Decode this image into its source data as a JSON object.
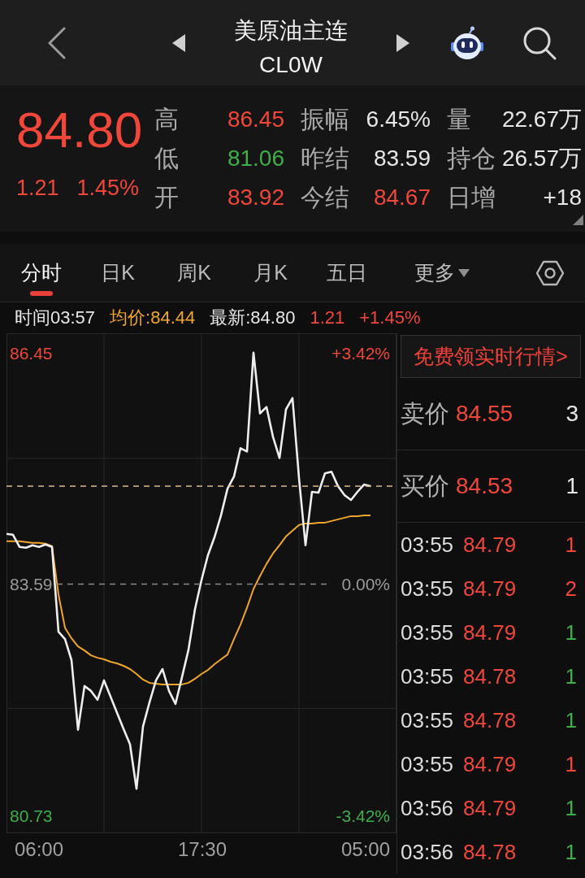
{
  "header": {
    "title": "美原油主连",
    "code": "CL0W"
  },
  "quote": {
    "price": "84.80",
    "change": "1.21",
    "change_pct": "1.45%",
    "color": "#f0473a",
    "stats": [
      {
        "label": "高",
        "value": "86.45",
        "color": "#f0473a"
      },
      {
        "label": "振幅",
        "value": "6.45%",
        "color": "#e6e6e6"
      },
      {
        "label": "量",
        "value": "22.67万",
        "color": "#e6e6e6"
      },
      {
        "label": "低",
        "value": "81.06",
        "color": "#3fae49"
      },
      {
        "label": "昨结",
        "value": "83.59",
        "color": "#e6e6e6"
      },
      {
        "label": "持仓",
        "value": "26.57万",
        "color": "#e6e6e6"
      },
      {
        "label": "开",
        "value": "83.92",
        "color": "#f0473a"
      },
      {
        "label": "今结",
        "value": "84.67",
        "color": "#f0473a"
      },
      {
        "label": "日增",
        "value": "+18",
        "color": "#e6e6e6"
      }
    ]
  },
  "tabs": [
    {
      "label": "分时",
      "selected": true,
      "kind": "plain"
    },
    {
      "label": "日K",
      "selected": false,
      "kind": "plain"
    },
    {
      "label": "周K",
      "selected": false,
      "kind": "plain"
    },
    {
      "label": "月K",
      "selected": false,
      "kind": "plain"
    },
    {
      "label": "五日",
      "selected": false,
      "kind": "plain"
    },
    {
      "label": "更多",
      "selected": false,
      "kind": "menu"
    }
  ],
  "info_line": [
    {
      "text": "时间03:57",
      "color": "#e6e6e6"
    },
    {
      "text": "均价:84.44",
      "color": "#f0a52b"
    },
    {
      "text": "最新:84.80",
      "color": "#e6e6e6"
    },
    {
      "text": "1.21",
      "color": "#f0473a"
    },
    {
      "text": "+1.45%",
      "color": "#f0473a"
    }
  ],
  "chart": {
    "chart_data": {
      "type": "line",
      "ylim": [
        80.51,
        86.69
      ],
      "yticks": [
        {
          "value": 80.73,
          "label": "80.73"
        },
        {
          "value": 83.59,
          "label": "83.59"
        },
        {
          "value": 86.45,
          "label": "86.45"
        }
      ],
      "grid": true,
      "series": [
        {
          "color": "#eeeeee",
          "values": [
            84.21,
            84.2,
            84.05,
            84.04,
            84.07,
            84.05,
            84.08,
            84.05,
            83.0,
            82.91,
            82.65,
            81.79,
            82.33,
            82.27,
            82.16,
            82.4,
            82.2,
            82.0,
            81.8,
            81.61,
            81.06,
            81.83,
            82.13,
            82.4,
            82.54,
            82.27,
            82.11,
            82.44,
            82.78,
            83.28,
            83.64,
            83.95,
            84.17,
            84.44,
            84.77,
            84.92,
            85.27,
            85.23,
            86.45,
            85.7,
            85.78,
            85.41,
            85.15,
            85.75,
            85.89,
            84.9,
            84.07,
            84.73,
            84.72,
            84.96,
            84.98,
            84.8,
            84.69,
            84.63,
            84.73,
            84.82,
            84.8,
            null,
            null,
            null,
            null
          ]
        },
        {
          "color": "#f0a52b",
          "values": [
            84.12,
            84.12,
            84.12,
            84.11,
            84.1,
            84.1,
            84.09,
            84.06,
            83.46,
            83.05,
            82.92,
            82.82,
            82.77,
            82.71,
            82.68,
            82.66,
            82.63,
            82.61,
            82.58,
            82.54,
            82.48,
            82.41,
            82.37,
            82.36,
            82.35,
            82.35,
            82.35,
            82.35,
            82.37,
            82.42,
            82.48,
            82.53,
            82.6,
            82.66,
            82.72,
            82.91,
            83.09,
            83.3,
            83.53,
            83.69,
            83.84,
            83.97,
            84.07,
            84.18,
            84.25,
            84.32,
            84.34,
            84.34,
            84.35,
            84.35,
            84.37,
            84.39,
            84.41,
            84.43,
            84.43,
            84.44,
            84.44,
            null,
            null,
            null,
            null
          ]
        }
      ]
    },
    "percent_labels": [
      {
        "text": "+3.42%",
        "color": "#f0473a"
      },
      {
        "text": "0.00%",
        "color": "#9a9a9a"
      },
      {
        "text": "-3.42%",
        "color": "#3fae49"
      }
    ],
    "time_labels": [
      "06:00",
      "17:30",
      "05:00"
    ]
  },
  "panel": {
    "promo": "免费领实时行情>",
    "quotes": [
      {
        "label": "卖价",
        "price": "84.55",
        "volume": "3"
      },
      {
        "label": "买价",
        "price": "84.53",
        "volume": "1"
      }
    ],
    "trades": [
      {
        "time": "03:55",
        "price": "84.79",
        "volume": "1",
        "color": "#f0473a"
      },
      {
        "time": "03:55",
        "price": "84.79",
        "volume": "2",
        "color": "#f0473a"
      },
      {
        "time": "03:55",
        "price": "84.79",
        "volume": "1",
        "color": "#3fae49"
      },
      {
        "time": "03:55",
        "price": "84.78",
        "volume": "1",
        "color": "#3fae49"
      },
      {
        "time": "03:55",
        "price": "84.78",
        "volume": "1",
        "color": "#3fae49"
      },
      {
        "time": "03:55",
        "price": "84.79",
        "volume": "1",
        "color": "#f0473a"
      },
      {
        "time": "03:56",
        "price": "84.79",
        "volume": "1",
        "color": "#3fae49"
      },
      {
        "time": "03:56",
        "price": "84.78",
        "volume": "1",
        "color": "#3fae49"
      }
    ]
  }
}
